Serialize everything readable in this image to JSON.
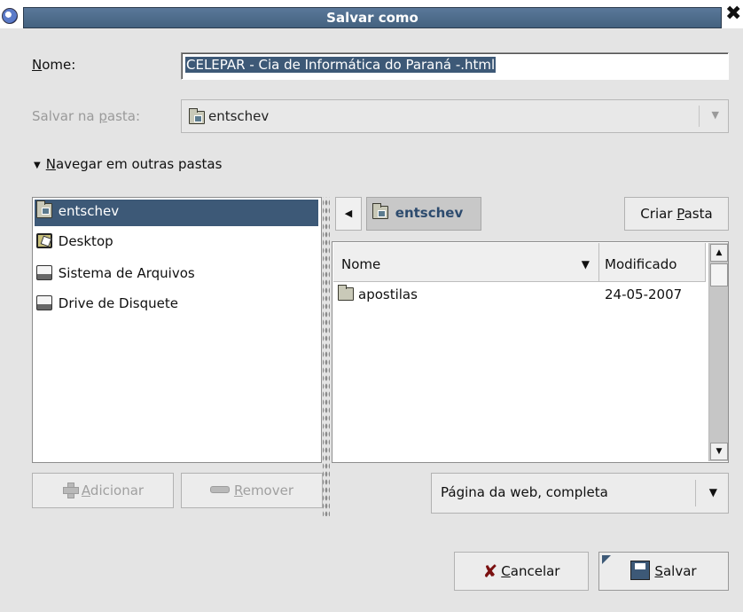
{
  "window": {
    "title": "Salvar como",
    "close_glyph": "✖"
  },
  "name_field": {
    "label_u": "N",
    "label_rest": "ome:",
    "value": "CELEPAR - Cia de Informática do Paraná -.html"
  },
  "folder_field": {
    "label_pre": "Salvar na ",
    "label_u": "p",
    "label_rest": "asta:",
    "value": "entschev"
  },
  "expander": {
    "label_u": "N",
    "label_rest": "avegar em outras pastas"
  },
  "places": [
    {
      "label": "entschev",
      "icon": "home-folder-icon"
    },
    {
      "label": "Desktop",
      "icon": "desktop-icon"
    },
    {
      "label": "Sistema de Arquivos",
      "icon": "drive-icon"
    },
    {
      "label": "Drive de Disquete",
      "icon": "floppy-icon"
    }
  ],
  "path_bar": {
    "current": "entschev",
    "create_pre": "Criar ",
    "create_u": "P",
    "create_rest": "asta"
  },
  "file_list": {
    "col_name": "Nome",
    "col_modified": "Modificado",
    "rows": [
      {
        "name": "apostilas",
        "date": "24-05-2007"
      }
    ]
  },
  "buttons": {
    "add_u": "A",
    "add_rest": "dicionar",
    "remove_u": "R",
    "remove_rest": "emover",
    "cancel_u": "C",
    "cancel_rest": "ancelar",
    "save_u": "S",
    "save_rest": "alvar"
  },
  "filter": {
    "value": "Página da web, completa"
  },
  "colors": {
    "selection": "#3d5977",
    "title_bar": "#4f6c8c",
    "background": "#e4e4e4"
  }
}
